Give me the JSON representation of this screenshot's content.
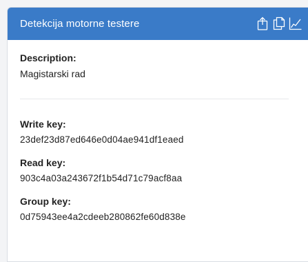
{
  "card": {
    "title": "Detekcija motorne testere",
    "header_icons": [
      "export-icon",
      "copy-icon",
      "chart-icon"
    ]
  },
  "description": {
    "label": "Description:",
    "value": "Magistarski rad"
  },
  "keys": [
    {
      "label": "Write key:",
      "value": "23def23d87ed646e0d04ae941df1eaed"
    },
    {
      "label": "Read key:",
      "value": "903c4a03a243672f1b54d71c79acf8aa"
    },
    {
      "label": "Group key:",
      "value": "0d75943ee4a2cdeeb280862fe60d838e"
    }
  ],
  "colors": {
    "header_bg": "#3a7bc8",
    "header_text": "#ffffff"
  }
}
